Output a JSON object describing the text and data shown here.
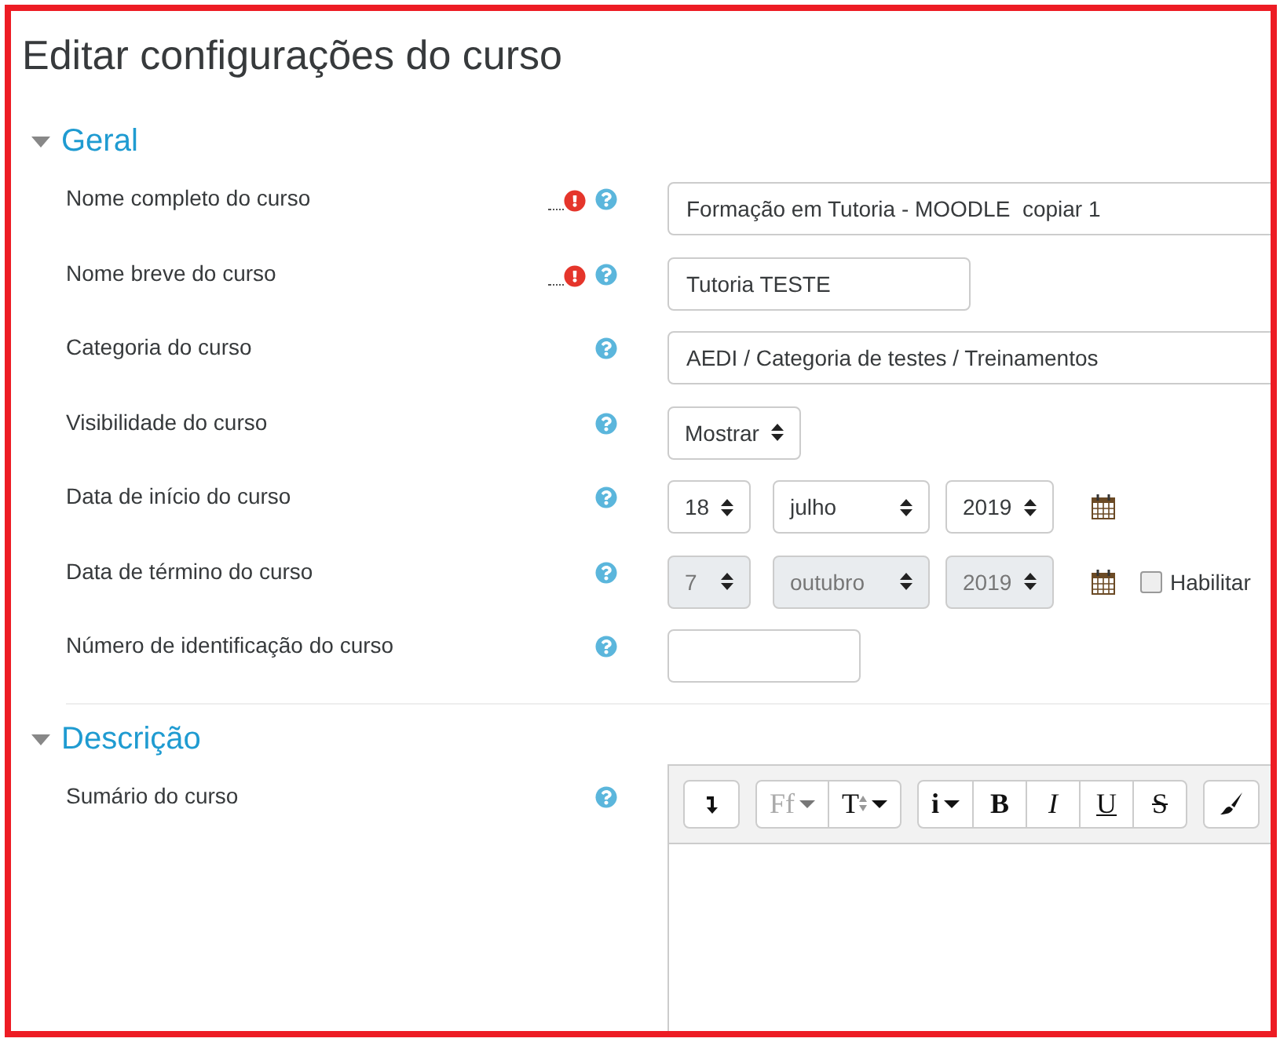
{
  "title": "Editar configurações do curso",
  "sections": [
    {
      "title": "Geral",
      "expanded": true,
      "fields": [
        {
          "kind": "wide_text",
          "label": "Nome completo do curso",
          "required": true,
          "value": "Formação em Tutoria - MOODLE  copiar 1"
        },
        {
          "kind": "text",
          "label": "Nome breve do curso",
          "required": true,
          "value": "Tutoria TESTE"
        },
        {
          "kind": "wide_text",
          "label": "Categoria do curso",
          "required": false,
          "value": "AEDI / Categoria de testes / Treinamentos"
        },
        {
          "kind": "select",
          "label": "Visibilidade do curso",
          "required": false,
          "value": "Mostrar"
        },
        {
          "kind": "date",
          "label": "Data de início do curso",
          "required": false,
          "disabled": false,
          "parts": [
            "18",
            "julho",
            "2019"
          ]
        },
        {
          "kind": "date",
          "label": "Data de término do curso",
          "required": false,
          "disabled": true,
          "parts": [
            "7",
            "outubro",
            "2019"
          ],
          "enable": {
            "label": "Habilitar",
            "checked": false
          }
        },
        {
          "kind": "short_text",
          "label": "Número de identificação do curso",
          "required": false
        }
      ]
    },
    {
      "title": "Descrição",
      "expanded": true,
      "fields": [
        {
          "kind": "editor",
          "label": "Sumário do curso",
          "required": false,
          "toolbar": [
            [
              {
                "kind": "collapse"
              }
            ],
            [
              {
                "kind": "font",
                "label": "Ff",
                "disabled": true
              },
              {
                "kind": "size",
                "label": "T",
                "disabled": false
              }
            ],
            [
              {
                "kind": "info",
                "label": "i",
                "disabled": false
              },
              {
                "kind": "bold",
                "label": "B",
                "disabled": false
              },
              {
                "kind": "italic",
                "label": "I",
                "disabled": false
              },
              {
                "kind": "underline",
                "label": "U",
                "disabled": false
              },
              {
                "kind": "strike",
                "label": "S",
                "disabled": false
              }
            ],
            [
              {
                "kind": "brush"
              }
            ]
          ]
        }
      ]
    }
  ]
}
